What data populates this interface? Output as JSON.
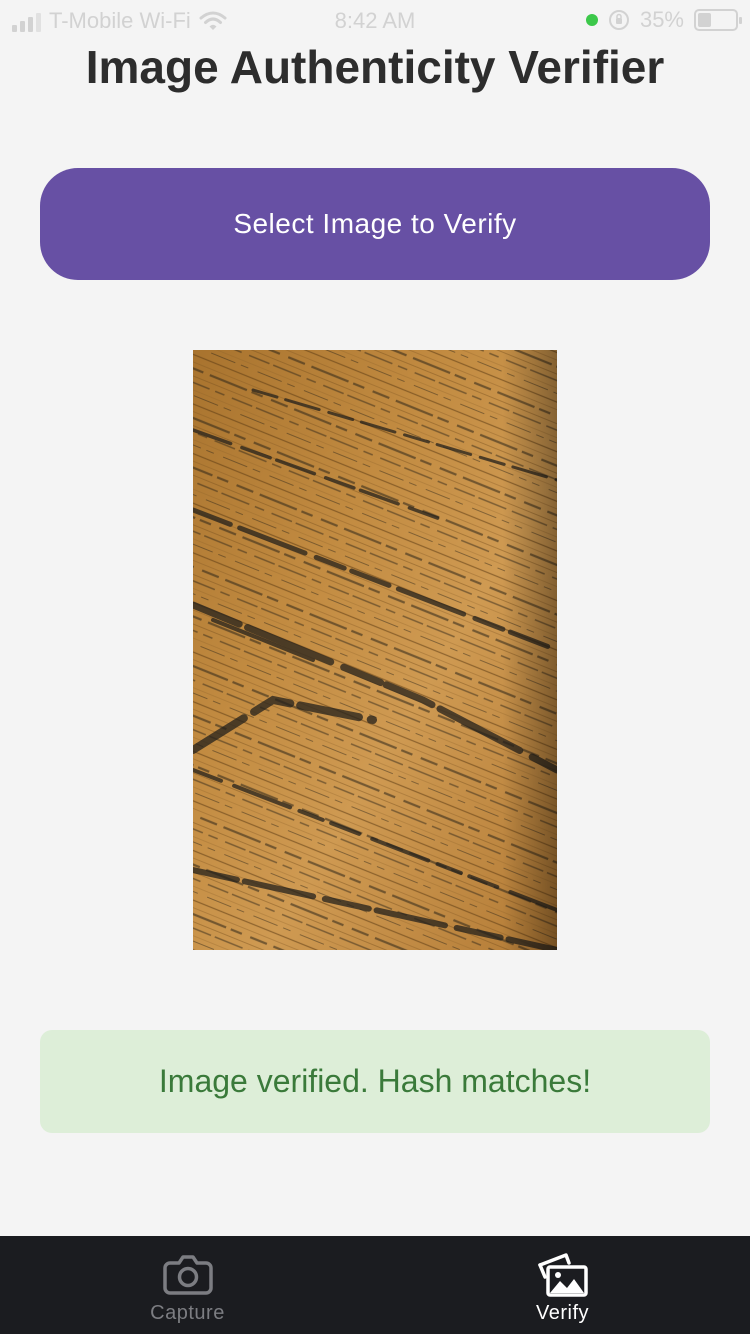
{
  "status_bar": {
    "carrier": "T-Mobile Wi-Fi",
    "time": "8:42 AM",
    "battery": "35%",
    "battery_level": 0.35
  },
  "header": {
    "title": "Image Authenticity Verifier"
  },
  "actions": {
    "select_label": "Select Image to Verify"
  },
  "result": {
    "message": "Image verified. Hash matches!"
  },
  "tabs": [
    {
      "label": "Capture",
      "icon": "camera-icon",
      "active": false
    },
    {
      "label": "Verify",
      "icon": "images-icon",
      "active": true
    }
  ],
  "colors": {
    "accent": "#6750a4",
    "success_bg": "#ddeed8",
    "success_text": "#3a7a3a",
    "tab_bar": "#1b1c20"
  }
}
